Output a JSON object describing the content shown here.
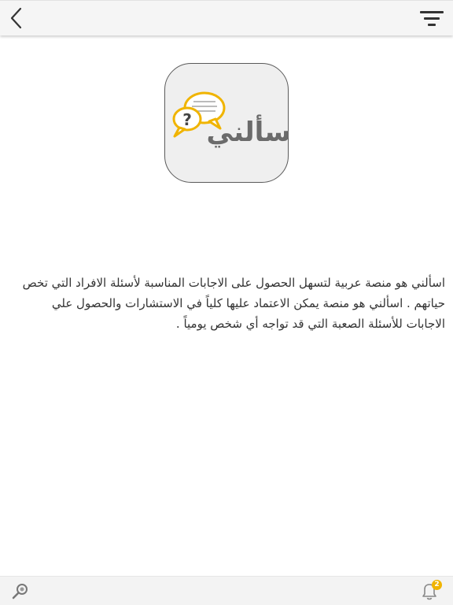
{
  "header": {
    "back_icon": "chevron-left-icon",
    "filter_icon": "filter-icon"
  },
  "logo": {
    "text": "اسألني",
    "bubble_mark": "?",
    "colors": {
      "accent": "#f0b400",
      "text": "#6b6b6b"
    }
  },
  "about": {
    "description": "اسألني هو منصة عربية لتسهل الحصول على الاجابات المناسبة لأسئلة الافراد التي تخص حياتهم . اسألني هو منصة يمكن الاعتماد عليها كلياً في الاستشارات والحصول علي الاجابات للأسئلة الصعبة التي قد تواجه أي شخص يومياً ."
  },
  "footer": {
    "search_icon": "search-icon",
    "bell_icon": "bell-icon",
    "notification_count": "2"
  }
}
